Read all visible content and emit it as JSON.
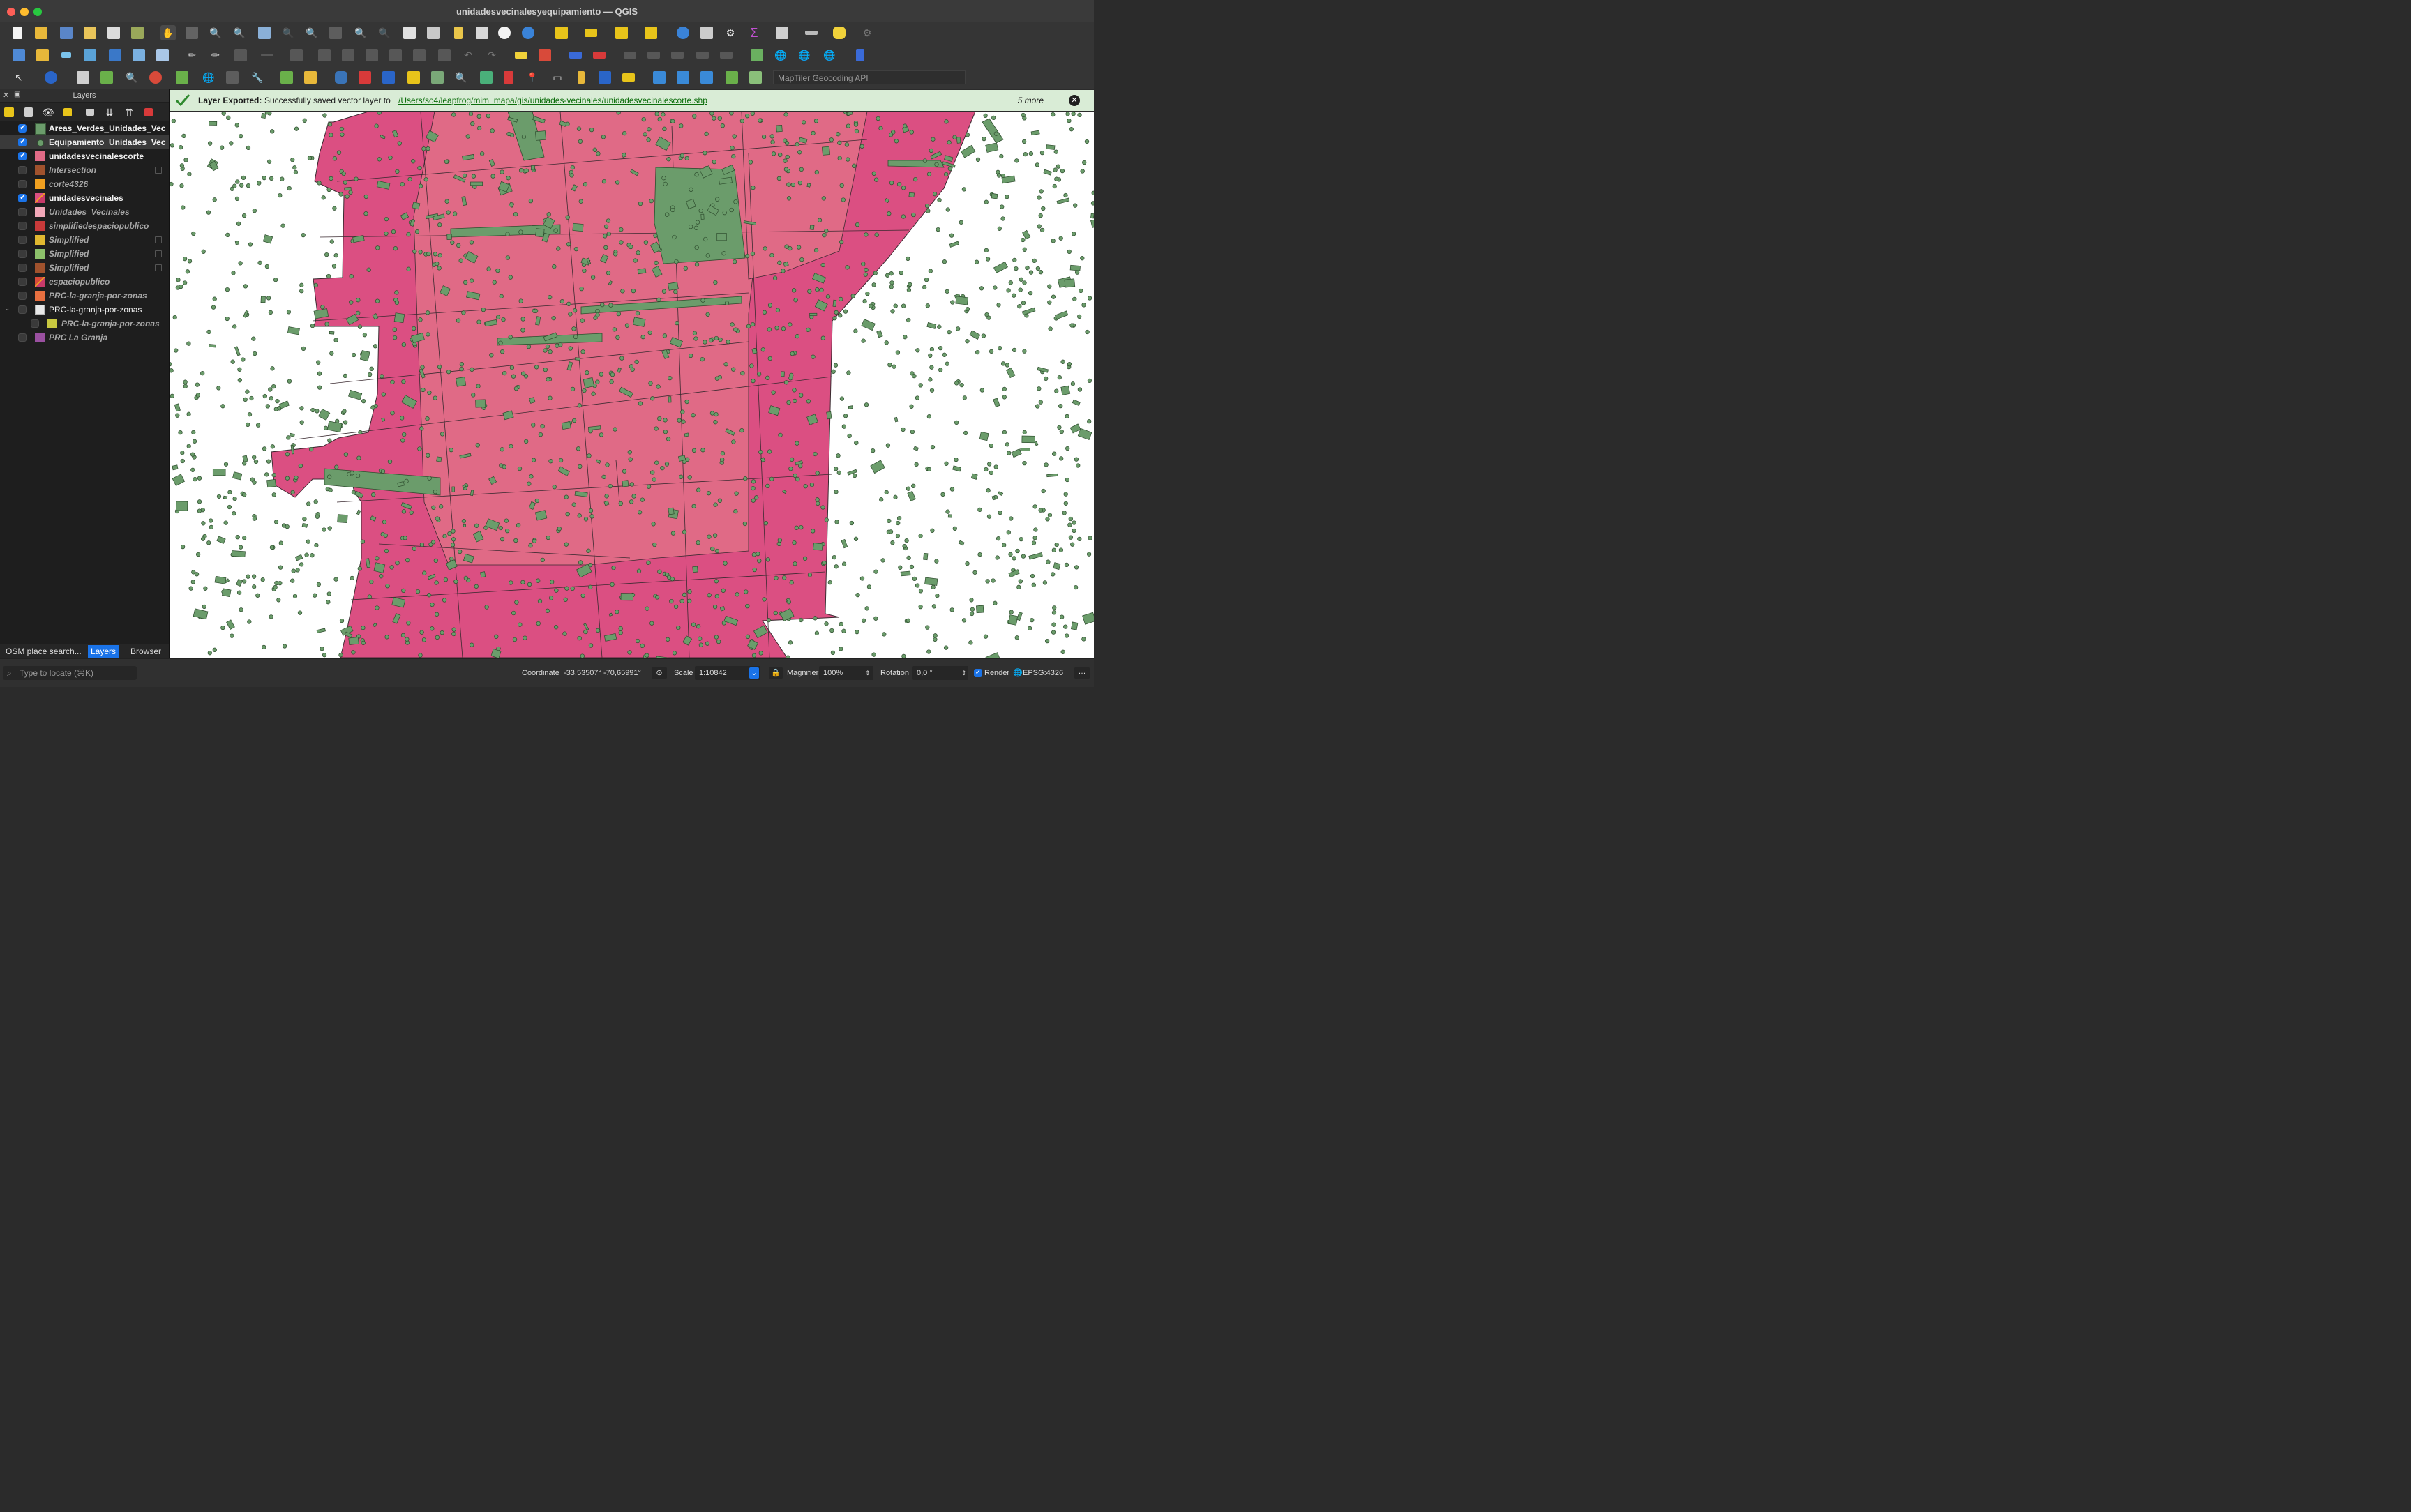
{
  "window": {
    "title": "unidadesvecinalesyequipamiento — QGIS"
  },
  "colors": {
    "polygon_fill": "#e06a86",
    "polygon_fill_dark": "#db4f82",
    "polygon_stroke": "#3a2a30",
    "green_fill": "#6b9c6b",
    "green_stroke": "#2e4d2e",
    "message_bg": "#d9ecd6",
    "accent": "#1a73e8"
  },
  "toolbar": {
    "geocoder_placeholder": "MapTiler Geocoding API"
  },
  "layers_panel": {
    "title": "Layers",
    "items": [
      {
        "name": "Areas_Verdes_Unidades_Vec",
        "checked": true,
        "symbol": "green-fill"
      },
      {
        "name": "Equipamiento_Unidades_Vec",
        "checked": true,
        "symbol": "green-point",
        "selected": true
      },
      {
        "name": "unidadesvecinalescorte",
        "checked": true,
        "symbol": "pink-fill"
      },
      {
        "name": "Intersection",
        "checked": false,
        "symbol": "brown-fill"
      },
      {
        "name": "corte4326",
        "checked": false,
        "symbol": "orange-fill"
      },
      {
        "name": "unidadesvecinales",
        "checked": true,
        "symbol": "multi-fill"
      },
      {
        "name": "Unidades_Vecinales",
        "checked": false,
        "symbol": "light-pink-fill"
      },
      {
        "name": "simplifiedespaciopublico",
        "checked": false,
        "symbol": "red-fill"
      },
      {
        "name": "Simplified",
        "checked": false,
        "symbol": "yellow-fill"
      },
      {
        "name": "Simplified",
        "checked": false,
        "symbol": "lightgreen-fill"
      },
      {
        "name": "Simplified",
        "checked": false,
        "symbol": "brown-fill"
      },
      {
        "name": "espaciopublico",
        "checked": false,
        "symbol": "multi-fill"
      },
      {
        "name": "PRC-la-granja-por-zonas",
        "checked": false,
        "symbol": "orange-fill"
      },
      {
        "name": "PRC-la-granja-por-zonas",
        "checked": false,
        "symbol": "group"
      },
      {
        "name": "PRC-la-granja-por-zonas",
        "checked": false,
        "symbol": "olive-fill"
      },
      {
        "name": "PRC La Granja",
        "checked": false,
        "symbol": "purple-fill"
      }
    ],
    "tabs": [
      "OSM place search...",
      "Layers",
      "Browser"
    ]
  },
  "message": {
    "title": "Layer Exported:",
    "text": "Successfully saved vector layer to",
    "link": "/Users/so4/leapfrog/mim_mapa/gis/unidades-vecinales/unidadesvecinalescorte.shp",
    "more": "5 more"
  },
  "statusbar": {
    "locate_placeholder": "Type to locate (⌘K)",
    "coordinate_label": "Coordinate",
    "coordinate_value": "-33,53507° -70,65991°",
    "scale_label": "Scale",
    "scale_value": "1:10842",
    "magnifier_label": "Magnifier",
    "magnifier_value": "100%",
    "rotation_label": "Rotation",
    "rotation_value": "0,0 °",
    "render_label": "Render",
    "crs": "EPSG:4326"
  }
}
